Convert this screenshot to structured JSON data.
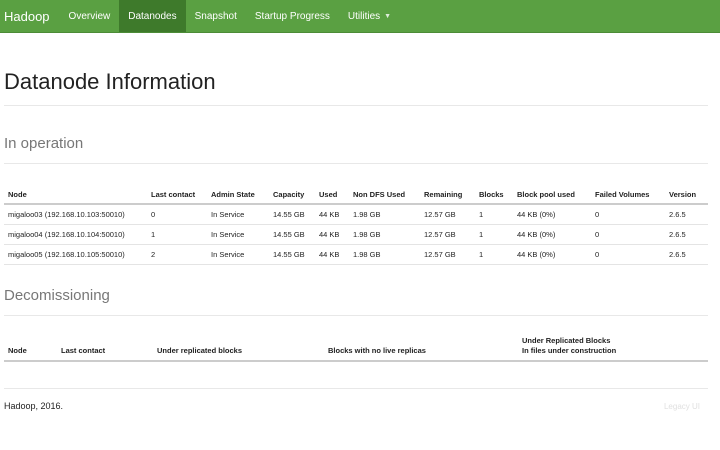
{
  "navbar": {
    "brand": "Hadoop",
    "items": [
      {
        "label": "Overview"
      },
      {
        "label": "Datanodes"
      },
      {
        "label": "Snapshot"
      },
      {
        "label": "Startup Progress"
      },
      {
        "label": "Utilities"
      }
    ]
  },
  "page_title": "Datanode Information",
  "in_operation": {
    "title": "In operation",
    "headers": [
      "Node",
      "Last contact",
      "Admin State",
      "Capacity",
      "Used",
      "Non DFS Used",
      "Remaining",
      "Blocks",
      "Block pool used",
      "Failed Volumes",
      "Version"
    ],
    "rows": [
      [
        "migaloo03 (192.168.10.103:50010)",
        "0",
        "In Service",
        "14.55 GB",
        "44 KB",
        "1.98 GB",
        "12.57 GB",
        "1",
        "44 KB (0%)",
        "0",
        "2.6.5"
      ],
      [
        "migaloo04 (192.168.10.104:50010)",
        "1",
        "In Service",
        "14.55 GB",
        "44 KB",
        "1.98 GB",
        "12.57 GB",
        "1",
        "44 KB (0%)",
        "0",
        "2.6.5"
      ],
      [
        "migaloo05 (192.168.10.105:50010)",
        "2",
        "In Service",
        "14.55 GB",
        "44 KB",
        "1.98 GB",
        "12.57 GB",
        "1",
        "44 KB (0%)",
        "0",
        "2.6.5"
      ]
    ]
  },
  "decommissioning": {
    "title": "Decomissioning",
    "headers": [
      "Node",
      "Last contact",
      "Under replicated blocks",
      "Blocks with no live replicas",
      "Under Replicated Blocks",
      "In files under construction"
    ]
  },
  "footer": {
    "copyright": "Hadoop, 2016.",
    "legacy": "Legacy UI"
  }
}
